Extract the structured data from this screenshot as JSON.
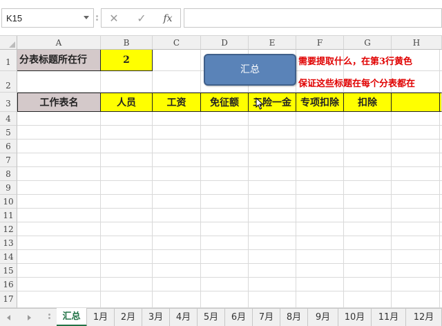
{
  "formula_bar": {
    "name_box": "K15",
    "cancel_icon": "✕",
    "enter_icon": "✓",
    "fx_label": "fx",
    "formula": ""
  },
  "columns": [
    "A",
    "B",
    "C",
    "D",
    "E",
    "F",
    "G",
    "H"
  ],
  "rows": [
    "1",
    "2",
    "3",
    "4",
    "5",
    "6",
    "7",
    "8",
    "9",
    "10",
    "11",
    "12",
    "13",
    "14",
    "15",
    "16",
    "17"
  ],
  "cells": {
    "a1": "分表标题所在行",
    "b1": "2",
    "a3": "工作表名",
    "b3": "人员",
    "c3": "工资",
    "d3": "免征额",
    "e3": "三险一金",
    "f3": "专项扣除",
    "g3": "扣除"
  },
  "notes": {
    "line1": "需要提取什么，在第3行黄色",
    "line2": "保证这些标题在每个分表都在"
  },
  "summary_button": "汇总",
  "sheet_tabs": [
    "汇总",
    "1月",
    "2月",
    "3月",
    "4月",
    "5月",
    "6月",
    "7月",
    "8月",
    "9月",
    "10月",
    "11月",
    "12月"
  ],
  "active_tab": "汇总",
  "colors": {
    "header_yellow": "#ffff00",
    "label_gray": "#d4c9ca",
    "button_blue": "#5a83b8",
    "note_red": "#e00000",
    "active_tab_green": "#217346"
  }
}
